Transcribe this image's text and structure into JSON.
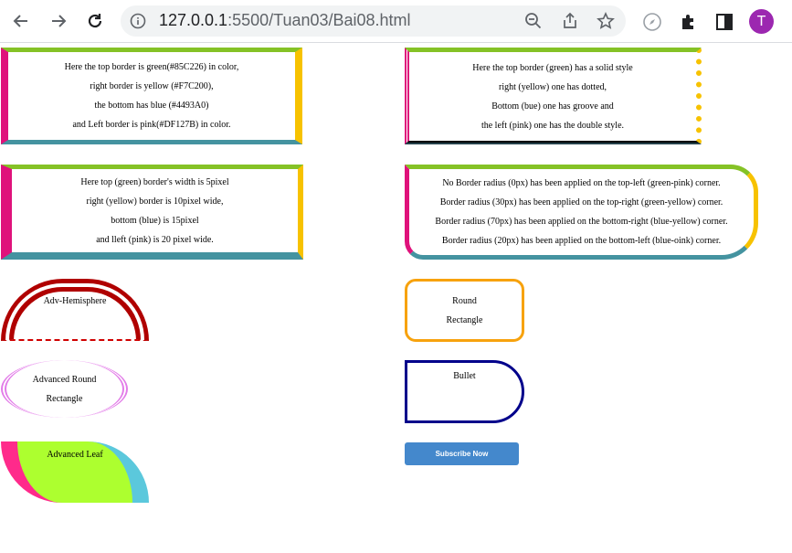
{
  "browser": {
    "url_host": "127.0.0.1",
    "url_rest": ":5500/Tuan03/Bai08.html",
    "avatar_letter": "T",
    "avatar_color": "#9c27b0"
  },
  "boxes": {
    "box1": {
      "lines": [
        "Here the top border is green(#85C226) in color,",
        "right border is yellow (#F7C200),",
        "the bottom has blue (#4493A0)",
        "and Left border is pink(#DF127B) in color."
      ]
    },
    "box2": {
      "lines": [
        "Here the top border (green) has a solid style",
        "right (yellow) one has dotted,",
        "Bottom (bue) one has groove and",
        "the left (pink) one has the double style."
      ]
    },
    "box3": {
      "lines": [
        "Here top (green) border's width is 5pixel",
        "right (yellow) border is 10pixel wide,",
        "bottom (blue) is 15pixel",
        "and lleft (pink) is 20 pixel wide."
      ]
    },
    "box4": {
      "lines": [
        "No Border radius (0px) has been applied on the top-left (green-pink) corner.",
        "Border radius (30px) has been applied on the top-right (green-yellow) corner.",
        "Border radius (70px) has been applied on the bottom-right (blue-yellow) corner.",
        "Border radius (20px) has been applied on the bottom-left (blue-oink) corner."
      ]
    }
  },
  "shapes": {
    "hemisphere": "Adv-Hemisphere",
    "round_rect": [
      "Round",
      "Rectangle"
    ],
    "adv_round_rect": [
      "Advanced Round",
      "Rectangle"
    ],
    "bullet": "Bullet",
    "leaf": "Advanced Leaf"
  },
  "subscribe_label": "Subscribe Now",
  "colors": {
    "green": "#85C226",
    "yellow": "#F7C200",
    "blue": "#4493A0",
    "pink": "#DF127B",
    "subscribe_bg": "#4488cc"
  }
}
